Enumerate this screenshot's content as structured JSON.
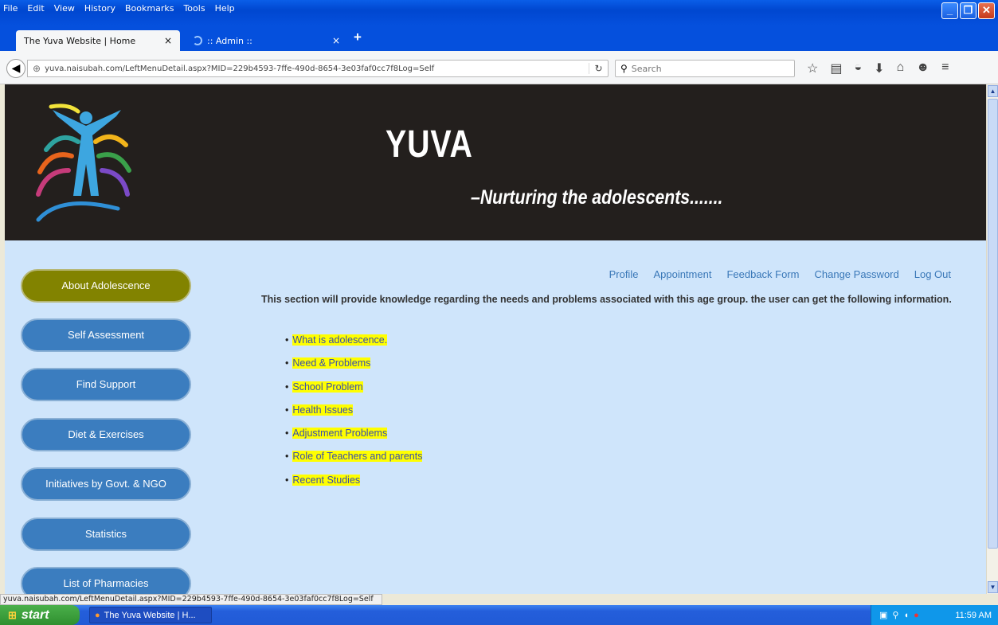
{
  "browser": {
    "menu": [
      "File",
      "Edit",
      "View",
      "History",
      "Bookmarks",
      "Tools",
      "Help"
    ],
    "tabs": [
      {
        "title": "The Yuva Website | Home"
      },
      {
        "title": ":: Admin ::"
      }
    ],
    "new_tab": "+",
    "tab_close": "×",
    "url": "yuva.naisubah.com/LeftMenuDetail.aspx?MID=229b4593-7ffe-490d-8654-3e03faf0cc7f8Log=Self",
    "search_placeholder": "Search",
    "status_url": "yuva.naisubah.com/LeftMenuDetail.aspx?MID=229b4593-7ffe-490d-8654-3e03faf0cc7f8Log=Self"
  },
  "site": {
    "title": "YUVA",
    "tagline": "–Nurturing the adolescents.......",
    "top_links": [
      "Profile",
      "Appointment",
      "Feedback Form",
      "Change Password",
      "Log Out"
    ],
    "sidebar": [
      {
        "label": "About Adolescence",
        "active": true
      },
      {
        "label": "Self Assessment"
      },
      {
        "label": "Find Support"
      },
      {
        "label": "Diet & Exercises"
      },
      {
        "label": "Initiatives by Govt. & NGO"
      },
      {
        "label": "Statistics"
      },
      {
        "label": "List of Pharmacies"
      }
    ],
    "intro": "This section will provide knowledge regarding the needs and problems associated with this age group. the user can get the following information.",
    "items": [
      "What is adolescence.",
      "Need & Problems",
      "School Problem",
      "Health Issues",
      "Adjustment Problems",
      "Role of Teachers and parents",
      "Recent Studies"
    ]
  },
  "taskbar": {
    "start": "start",
    "task": "The Yuva Website | H...",
    "clock": "11:59 AM"
  },
  "colors": {
    "banner_bg": "#231f1d",
    "page_bg": "#cfe5fb",
    "sidebar_button": "#3b7dbf",
    "sidebar_active": "#828300",
    "highlight": "#ffff00",
    "link": "#3a78b8"
  }
}
